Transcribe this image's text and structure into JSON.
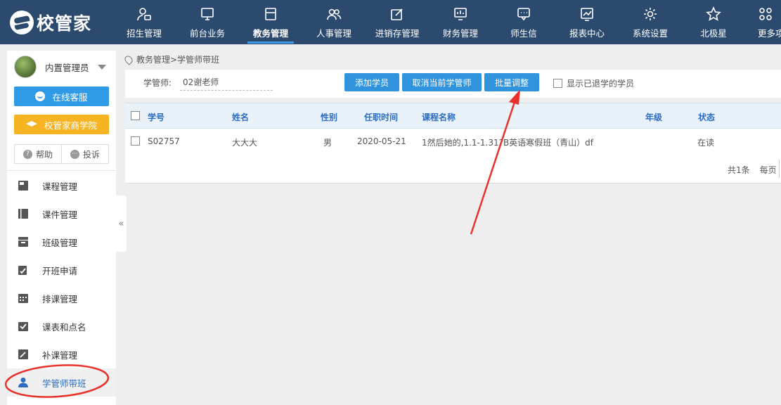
{
  "app": {
    "logo_text": "校管家"
  },
  "nav": {
    "items": [
      {
        "label": "招生管理",
        "icon": "user-card-icon"
      },
      {
        "label": "前台业务",
        "icon": "monitor-icon"
      },
      {
        "label": "教务管理",
        "icon": "folder-icon",
        "active": true
      },
      {
        "label": "人事管理",
        "icon": "people-icon"
      },
      {
        "label": "进销存管理",
        "icon": "edit-box-icon"
      },
      {
        "label": "财务管理",
        "icon": "screen-chart-icon"
      },
      {
        "label": "师生信",
        "icon": "chat-icon"
      },
      {
        "label": "报表中心",
        "icon": "report-chart-icon"
      },
      {
        "label": "系统设置",
        "icon": "gear-icon"
      },
      {
        "label": "北极星",
        "icon": "star-icon"
      },
      {
        "label": "更多项",
        "icon": "grid-icon"
      }
    ]
  },
  "sidebar": {
    "user_name": "内置管理员",
    "service_button": "在线客服",
    "academy_button": "校管家商学院",
    "help_label": "帮助",
    "complaint_label": "投诉",
    "menu": [
      {
        "label": "课程管理",
        "icon": "course-icon"
      },
      {
        "label": "课件管理",
        "icon": "book-icon"
      },
      {
        "label": "班级管理",
        "icon": "class-icon"
      },
      {
        "label": "开班申请",
        "icon": "apply-icon"
      },
      {
        "label": "排课管理",
        "icon": "calendar-icon"
      },
      {
        "label": "课表和点名",
        "icon": "checkin-icon"
      },
      {
        "label": "补课管理",
        "icon": "makeup-icon"
      },
      {
        "label": "学管师带班",
        "icon": "teacher-icon",
        "active": true
      }
    ],
    "collapse_glyph": "«"
  },
  "breadcrumb": "教务管理>学管师带班",
  "toolbar": {
    "advisor_label": "学管师:",
    "advisor_value": "02谢老师",
    "add_student": "添加学员",
    "cancel_advisor": "取消当前学管师",
    "batch_adjust": "批量调整",
    "show_withdrawn": "显示已退学的学员"
  },
  "table": {
    "headers": {
      "id": "学号",
      "name": "姓名",
      "gender": "性别",
      "hire_date": "任职时间",
      "course": "课程名称",
      "grade": "年级",
      "status": "状态"
    },
    "rows": [
      {
        "id": "S02757",
        "name": "大大大",
        "gender": "男",
        "hire_date": "2020-05-21",
        "course": "1然后她的,1.1-1.31?B英语寒假班（青山）df",
        "grade": "",
        "status": "在读"
      }
    ],
    "total": "共1条",
    "per_page": "每页"
  },
  "colors": {
    "topbar": "#2c4a6e",
    "primary_button": "#2f93dd",
    "service_button": "#2f9be6",
    "academy_button": "#f7b422",
    "annotation": "#e8322b"
  }
}
